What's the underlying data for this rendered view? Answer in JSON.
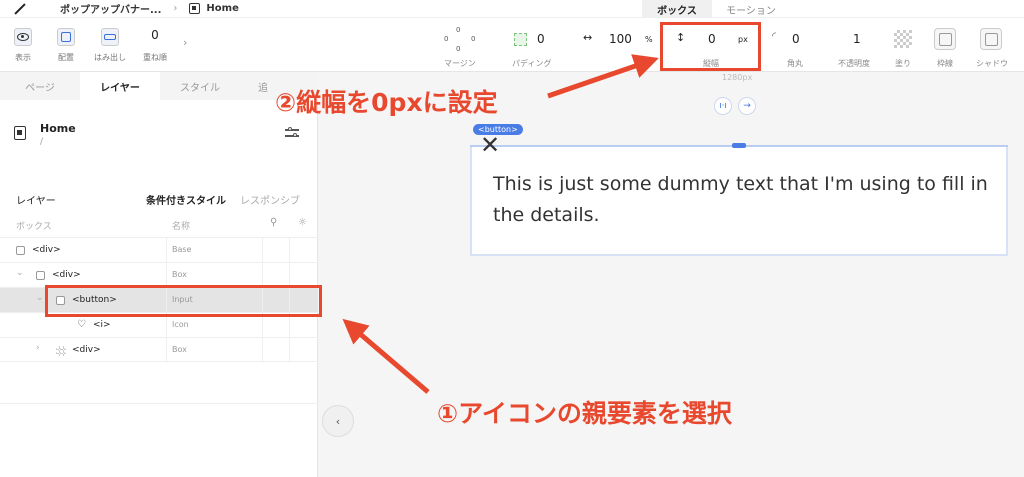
{
  "topbar": {
    "breadcrumb": "ポップアップバナー...",
    "page": "Home",
    "tabs": [
      "ボックス",
      "モーション"
    ]
  },
  "toolbar": {
    "display_label": "表示",
    "placement_label": "配置",
    "overflow_label": "はみ出し",
    "zindex_value": "0",
    "zindex_label": "重ね順",
    "margin": {
      "top": "0",
      "left": "0",
      "right": "0",
      "bottom": "0",
      "label": "マージン"
    },
    "padding": {
      "value": "0",
      "label": "パディング"
    },
    "width": {
      "value": "100",
      "unit": "%"
    },
    "height": {
      "value": "0",
      "unit": "px",
      "label": "縦幅"
    },
    "radius": {
      "value": "0",
      "label": "角丸"
    },
    "opacity": {
      "value": "1",
      "label": "不透明度"
    },
    "fill_label": "塗り",
    "border_label": "枠線",
    "shadow_label": "シャドウ"
  },
  "panel": {
    "tabs": [
      "ページ",
      "レイヤー",
      "スタイル",
      "追"
    ],
    "page_name": "Home",
    "page_path": "/",
    "layers_title": "レイヤー",
    "conditional_style": "条件付きスタイル",
    "responsive": "レスポンシブ",
    "col_box": "ボックス",
    "col_name": "名称",
    "rows": [
      {
        "tag": "<div>",
        "type": "Base"
      },
      {
        "tag": "<div>",
        "type": "Box"
      },
      {
        "tag": "<button>",
        "type": "Input"
      },
      {
        "tag": "<i>",
        "type": "Icon"
      },
      {
        "tag": "<div>",
        "type": "Box"
      }
    ]
  },
  "canvas": {
    "width_label": "1280px",
    "selected_tag": "<button>",
    "text": "This is just some dummy text that I'm using to fill in the details."
  },
  "annotations": {
    "step1": "①アイコンの親要素を選択",
    "step2": "②縦幅を0pxに設定"
  },
  "colors": {
    "accent": "#e8492e",
    "selection": "#4a7ce6"
  }
}
